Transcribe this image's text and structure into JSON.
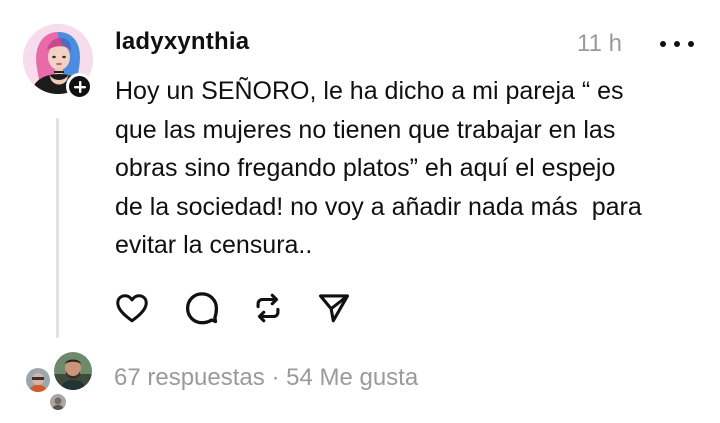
{
  "post": {
    "username": "ladyxynthia",
    "time": "11 h",
    "text": "Hoy un SEÑORO, le ha dicho a mi pareja “ es\nque las mujeres no tienen que trabajar en las\nobras sino fregando platos” eh aquí el espejo\nde la sociedad! no voy a añadir nada más  para\nevitar la censura..",
    "avatar_icon": "user-avatar-pink-blue-hair",
    "follow_icon": "plus-icon"
  },
  "actions": {
    "icons": [
      "heart-icon",
      "comment-icon",
      "repost-icon",
      "share-icon"
    ]
  },
  "footer": {
    "replies": "67 respuestas",
    "separator": "·",
    "likes": "54 Me gusta"
  },
  "colors": {
    "text": "#101010",
    "muted": "#9a9a9a",
    "thread_line": "#e3e3e3",
    "accent_pink": "#e86aa8",
    "accent_blue": "#4b8de0"
  }
}
